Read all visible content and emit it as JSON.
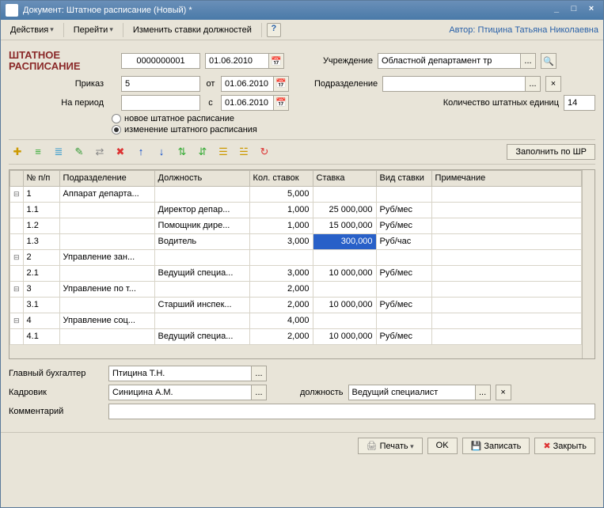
{
  "window": {
    "title": "Документ: Штатное расписание (Новый) *"
  },
  "menu": {
    "actions": "Действия",
    "goto": "Перейти",
    "change_rates": "Изменить ставки должностей",
    "help": "?",
    "author_label": "Автор:",
    "author_value": "Птицина Татьяна Николаевна"
  },
  "header": {
    "title1": "ШТАТНОЕ",
    "title2": "РАСПИСАНИЕ",
    "number": "0000000001",
    "number_date": "01.06.2010",
    "prikaz_label": "Приказ",
    "prikaz": "5",
    "ot_label": "от",
    "prikaz_date": "01.06.2010",
    "period_label": "На период",
    "period_from": "",
    "s_label": "с",
    "period_to": "01.06.2010",
    "uchr_label": "Учреждение",
    "uchr": "Областной департамент тр",
    "podr_label": "Подразделение",
    "podr": "",
    "units_label": "Количество штатных единиц",
    "units": "14",
    "radio_new": "новое штатное расписание",
    "radio_change": "изменение штатного расписания"
  },
  "toolbar": {
    "fill_btn": "Заполнить по ШР"
  },
  "table": {
    "cols": {
      "npp": "№ п/п",
      "podr": "Подразделение",
      "dolzh": "Должность",
      "kol": "Кол. ставок",
      "stavka": "Ставка",
      "vid": "Вид ставки",
      "prim": "Примечание"
    },
    "rows": [
      {
        "exp": "⊟",
        "n": "1",
        "podr": "Аппарат департа...",
        "dolzh": "",
        "kol": "5,000",
        "stavka": "",
        "vid": "",
        "prim": ""
      },
      {
        "exp": "",
        "n": "1.1",
        "podr": "",
        "dolzh": "Директор депар...",
        "kol": "1,000",
        "stavka": "25 000,000",
        "vid": "Руб/мес",
        "prim": ""
      },
      {
        "exp": "",
        "n": "1.2",
        "podr": "",
        "dolzh": "Помощник дире...",
        "kol": "1,000",
        "stavka": "15 000,000",
        "vid": "Руб/мес",
        "prim": ""
      },
      {
        "exp": "",
        "n": "1.3",
        "podr": "",
        "dolzh": "Водитель",
        "kol": "3,000",
        "stavka": "300,000",
        "vid": "Руб/час",
        "prim": "",
        "sel": true
      },
      {
        "exp": "⊟",
        "n": "2",
        "podr": "Управление зан...",
        "dolzh": "",
        "kol": "",
        "stavka": "",
        "vid": "",
        "prim": ""
      },
      {
        "exp": "",
        "n": "2.1",
        "podr": "",
        "dolzh": "Ведущий специа...",
        "kol": "3,000",
        "stavka": "10 000,000",
        "vid": "Руб/мес",
        "prim": ""
      },
      {
        "exp": "⊟",
        "n": "3",
        "podr": "Управление по т...",
        "dolzh": "",
        "kol": "2,000",
        "stavka": "",
        "vid": "",
        "prim": ""
      },
      {
        "exp": "",
        "n": "3.1",
        "podr": "",
        "dolzh": "Старший инспек...",
        "kol": "2,000",
        "stavka": "10 000,000",
        "vid": "Руб/мес",
        "prim": ""
      },
      {
        "exp": "⊟",
        "n": "4",
        "podr": "Управление соц...",
        "dolzh": "",
        "kol": "4,000",
        "stavka": "",
        "vid": "",
        "prim": ""
      },
      {
        "exp": "",
        "n": "4.1",
        "podr": "",
        "dolzh": "Ведущий специа...",
        "kol": "2,000",
        "stavka": "10 000,000",
        "vid": "Руб/мес",
        "prim": ""
      }
    ]
  },
  "footer": {
    "glavbuh_label": "Главный бухгалтер",
    "glavbuh": "Птицина Т.Н.",
    "kadrovik_label": "Кадровик",
    "kadrovik": "Синицина А.М.",
    "dolzh_label": "должность",
    "dolzh": "Ведущий специалист",
    "comment_label": "Комментарий",
    "comment": ""
  },
  "buttons": {
    "print": "Печать",
    "ok": "OK",
    "save": "Записать",
    "close": "Закрыть"
  }
}
